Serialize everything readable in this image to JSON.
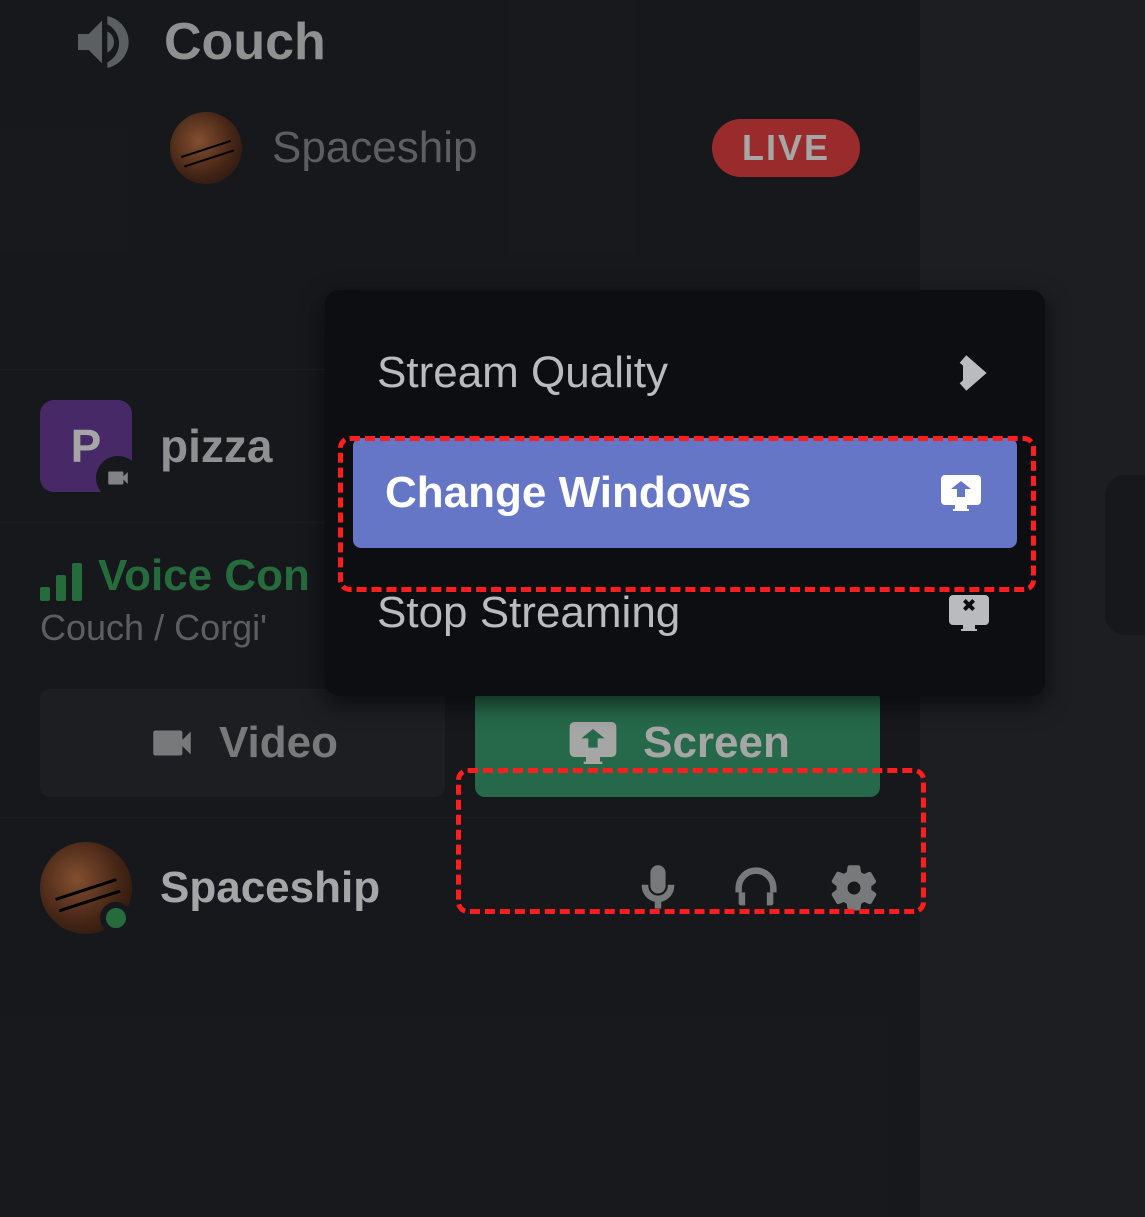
{
  "channel": {
    "name": "Couch"
  },
  "member": {
    "name": "Spaceship",
    "live_badge": "LIVE"
  },
  "activity": {
    "letter": "P",
    "name": "pizza"
  },
  "voice": {
    "status": "Voice Con",
    "location": "Couch / Corgi'"
  },
  "buttons": {
    "video": "Video",
    "screen": "Screen"
  },
  "user": {
    "name": "Spaceship"
  },
  "menu": {
    "stream_quality": "Stream Quality",
    "change_windows": "Change Windows",
    "stop_streaming": "Stop Streaming"
  }
}
